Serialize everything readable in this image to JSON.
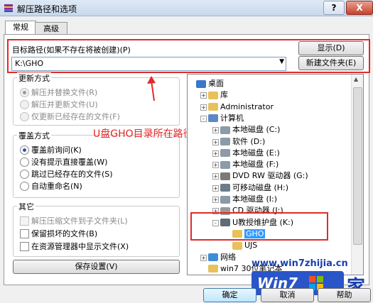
{
  "window": {
    "title": "解压路径和选项",
    "help_label": "?",
    "close_label": "X"
  },
  "tabs": [
    {
      "label": "常规",
      "active": true
    },
    {
      "label": "高级",
      "active": false
    }
  ],
  "path": {
    "label": "目标路径(如果不存在将被创建)(P)",
    "value": "K:\\GHO",
    "show_button": "显示(D)",
    "new_folder_button": "新建文件夹(E)"
  },
  "update_mode": {
    "title": "更新方式",
    "options": [
      {
        "label": "解压并替换文件(R)",
        "selected": true,
        "enabled": false
      },
      {
        "label": "解压并更新文件(U)",
        "selected": false,
        "enabled": false
      },
      {
        "label": "仅更新已经存在的文件(F)",
        "selected": false,
        "enabled": false
      }
    ]
  },
  "overwrite_mode": {
    "title": "覆盖方式",
    "options": [
      {
        "label": "覆盖前询问(K)",
        "selected": true
      },
      {
        "label": "没有提示直接覆盖(W)",
        "selected": false
      },
      {
        "label": "跳过已经存在的文件(S)",
        "selected": false
      },
      {
        "label": "自动重命名(N)",
        "selected": false
      }
    ]
  },
  "misc": {
    "title": "其它",
    "options": [
      {
        "label": "解压压缩文件到子文件夹(L)",
        "checked": false,
        "enabled": false
      },
      {
        "label": "保留损坏的文件(B)",
        "checked": false,
        "enabled": true
      },
      {
        "label": "在资源管理器中显示文件(X)",
        "checked": false,
        "enabled": true
      }
    ]
  },
  "save_settings_button": "保存设置(V)",
  "annotation": "U盘GHO目录所在路径",
  "tree": {
    "items": [
      {
        "label": "桌面",
        "icon": "desktop-icon",
        "level": 0,
        "expander": ""
      },
      {
        "label": "库",
        "icon": "folder-icon",
        "level": 1,
        "expander": "+"
      },
      {
        "label": "Administrator",
        "icon": "user-folder-icon",
        "level": 1,
        "expander": "+"
      },
      {
        "label": "计算机",
        "icon": "computer-icon",
        "level": 1,
        "expander": "-"
      },
      {
        "label": "本地磁盘 (C:)",
        "icon": "drive-icon",
        "level": 2,
        "expander": "+"
      },
      {
        "label": "软件 (D:)",
        "icon": "drive-icon",
        "level": 2,
        "expander": "+"
      },
      {
        "label": "本地磁盘 (E:)",
        "icon": "drive-icon",
        "level": 2,
        "expander": "+"
      },
      {
        "label": "本地磁盘 (F:)",
        "icon": "drive-icon",
        "level": 2,
        "expander": "+"
      },
      {
        "label": "DVD RW 驱动器 (G:)",
        "icon": "dvd-drive-icon",
        "level": 2,
        "expander": "+"
      },
      {
        "label": "可移动磁盘 (H:)",
        "icon": "removable-drive-icon",
        "level": 2,
        "expander": "+"
      },
      {
        "label": "本地磁盘 (I:)",
        "icon": "drive-icon",
        "level": 2,
        "expander": "+"
      },
      {
        "label": "CD 驱动器 (J:)",
        "icon": "cd-drive-icon",
        "level": 2,
        "expander": "+"
      },
      {
        "label": "U教授维护盘 (K:)",
        "icon": "usb-drive-icon",
        "level": 2,
        "expander": "-"
      },
      {
        "label": "GHO",
        "icon": "folder-icon",
        "level": 3,
        "expander": "",
        "selected": true
      },
      {
        "label": "UJS",
        "icon": "folder-icon",
        "level": 3,
        "expander": ""
      },
      {
        "label": "网络",
        "icon": "network-icon",
        "level": 1,
        "expander": "+"
      },
      {
        "label": "win7 30位笔记本",
        "icon": "folder-icon",
        "level": 1,
        "expander": ""
      }
    ]
  },
  "buttons": {
    "ok": "确定",
    "cancel": "取消",
    "help": "帮助"
  },
  "watermark": {
    "url": "www.win7zhijia.cn",
    "brand": "Win7",
    "suffix": "家"
  },
  "colors": {
    "annotation_red": "#e02a2a",
    "selection_blue": "#3399ff",
    "link_blue": "#1a3fb0"
  }
}
